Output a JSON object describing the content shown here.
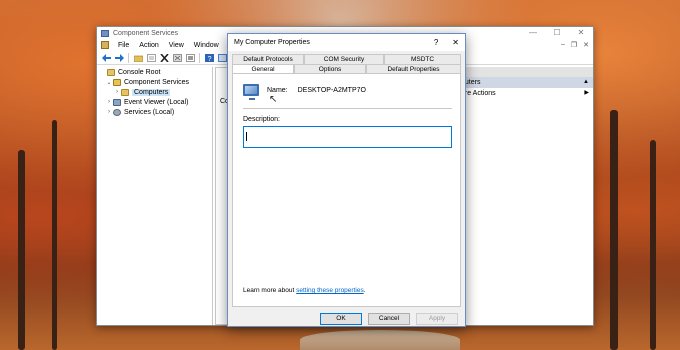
{
  "main_window": {
    "title": "Component Services",
    "window_controls": {
      "minimize": "—",
      "maximize": "☐",
      "close": "✕"
    },
    "inner_controls": {
      "minimize": "–",
      "restore": "❐",
      "close": "✕"
    },
    "menu": [
      "File",
      "Action",
      "View",
      "Window",
      "He"
    ],
    "tree": [
      {
        "label": "Console Root",
        "icon": "folder-icon",
        "arrow": "",
        "indent": 0
      },
      {
        "label": "Component Services",
        "icon": "component-services-icon",
        "arrow": "⌄",
        "indent": 1
      },
      {
        "label": "Computers",
        "icon": "folder-icon",
        "arrow": "›",
        "indent": 2,
        "selected": true
      },
      {
        "label": "Event Viewer (Local)",
        "icon": "event-viewer-icon",
        "arrow": "›",
        "indent": 1
      },
      {
        "label": "Services (Local)",
        "icon": "services-icon",
        "arrow": "›",
        "indent": 1
      }
    ],
    "center_stub": "Co",
    "actions": {
      "header": "s",
      "sub": "puters",
      "more": "ore Actions"
    }
  },
  "dialog": {
    "title": "My Computer Properties",
    "help": "?",
    "close": "✕",
    "tabs_row1": [
      "Default Protocols",
      "COM Security",
      "MSDTC"
    ],
    "tabs_row2": [
      "General",
      "Options",
      "Default Properties"
    ],
    "active_tab": "General",
    "name_label": "Name:",
    "name_value": "DESKTOP-A2MTP7O",
    "description_label": "Description:",
    "description_value": "",
    "learn_more_prefix": "Learn more about ",
    "learn_more_link": "setting these properties",
    "learn_more_suffix": ".",
    "buttons": {
      "ok": "OK",
      "cancel": "Cancel",
      "apply": "Apply"
    }
  },
  "colors": {
    "accent": "#0078d7",
    "link": "#0066cc",
    "selected": "#cce4f7"
  }
}
